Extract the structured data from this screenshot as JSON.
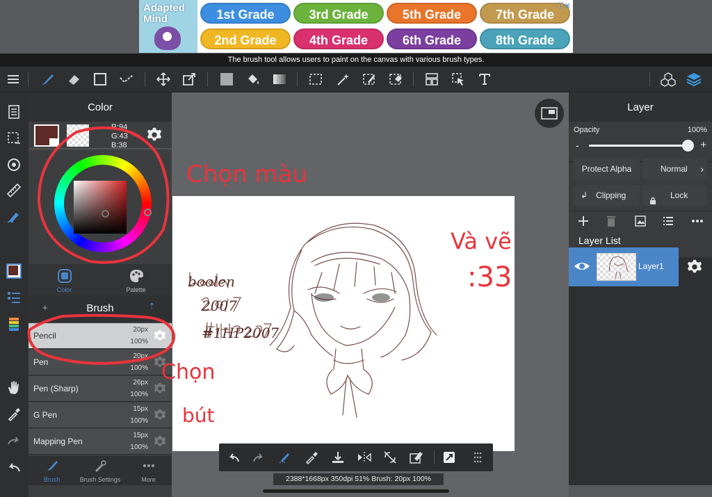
{
  "ad": {
    "logo_line1": "Adapted",
    "logo_line2": "Mind",
    "grades": [
      {
        "label": "1st Grade",
        "color": "#3d8ee0"
      },
      {
        "label": "3rd Grade",
        "color": "#6cb33e"
      },
      {
        "label": "5th Grade",
        "color": "#e8752a"
      },
      {
        "label": "7th Grade",
        "color": "#c29a4f"
      },
      {
        "label": "2nd Grade",
        "color": "#f0b724"
      },
      {
        "label": "4th Grade",
        "color": "#d9306e"
      },
      {
        "label": "6th Grade",
        "color": "#7b3fa0"
      },
      {
        "label": "8th Grade",
        "color": "#4aa3b8"
      }
    ]
  },
  "tooltip": "The brush tool allows users to paint on the canvas with various brush types.",
  "color_panel": {
    "title": "Color",
    "rgb_r": "R:94",
    "rgb_g": "G:43",
    "rgb_b": "B:38",
    "tab_color": "Color",
    "tab_palette": "Palette",
    "current_color": "#5e2b26"
  },
  "brush_panel": {
    "title": "Brush",
    "brushes": [
      {
        "name": "Pencil",
        "size": "20px",
        "opacity": "100%"
      },
      {
        "name": "Pen",
        "size": "20px",
        "opacity": "100%"
      },
      {
        "name": "Pen (Sharp)",
        "size": "26px",
        "opacity": "100%"
      },
      {
        "name": "G Pen",
        "size": "15px",
        "opacity": "100%"
      },
      {
        "name": "Mapping Pen",
        "size": "15px",
        "opacity": "100%"
      }
    ],
    "tabs": [
      "Brush",
      "Brush Settings",
      "More"
    ]
  },
  "layer_panel": {
    "title": "Layer",
    "opacity_label": "Opacity",
    "opacity_value": "100%",
    "opacity_level": 1.0,
    "minus": "-",
    "plus": "+",
    "protect_alpha": "Protect Alpha",
    "blend_mode": "Normal",
    "clipping": "Clipping",
    "lock": "Lock",
    "layer_list_title": "Layer List",
    "layers": [
      {
        "name": "Layer1"
      }
    ]
  },
  "annotations": {
    "chon_mau": "Chọn màu",
    "va_ve": "Và vẽ",
    "smile": ":33",
    "chon": "Chọn",
    "but": "bút",
    "sig1": "boolen",
    "sig2": "2007",
    "sig3": "#1HP2007"
  },
  "status_text": "2388*1668px 350dpi 51% Brush: 20px 100%",
  "accent": "#4a86c7",
  "annotation_color": "#e8343c"
}
